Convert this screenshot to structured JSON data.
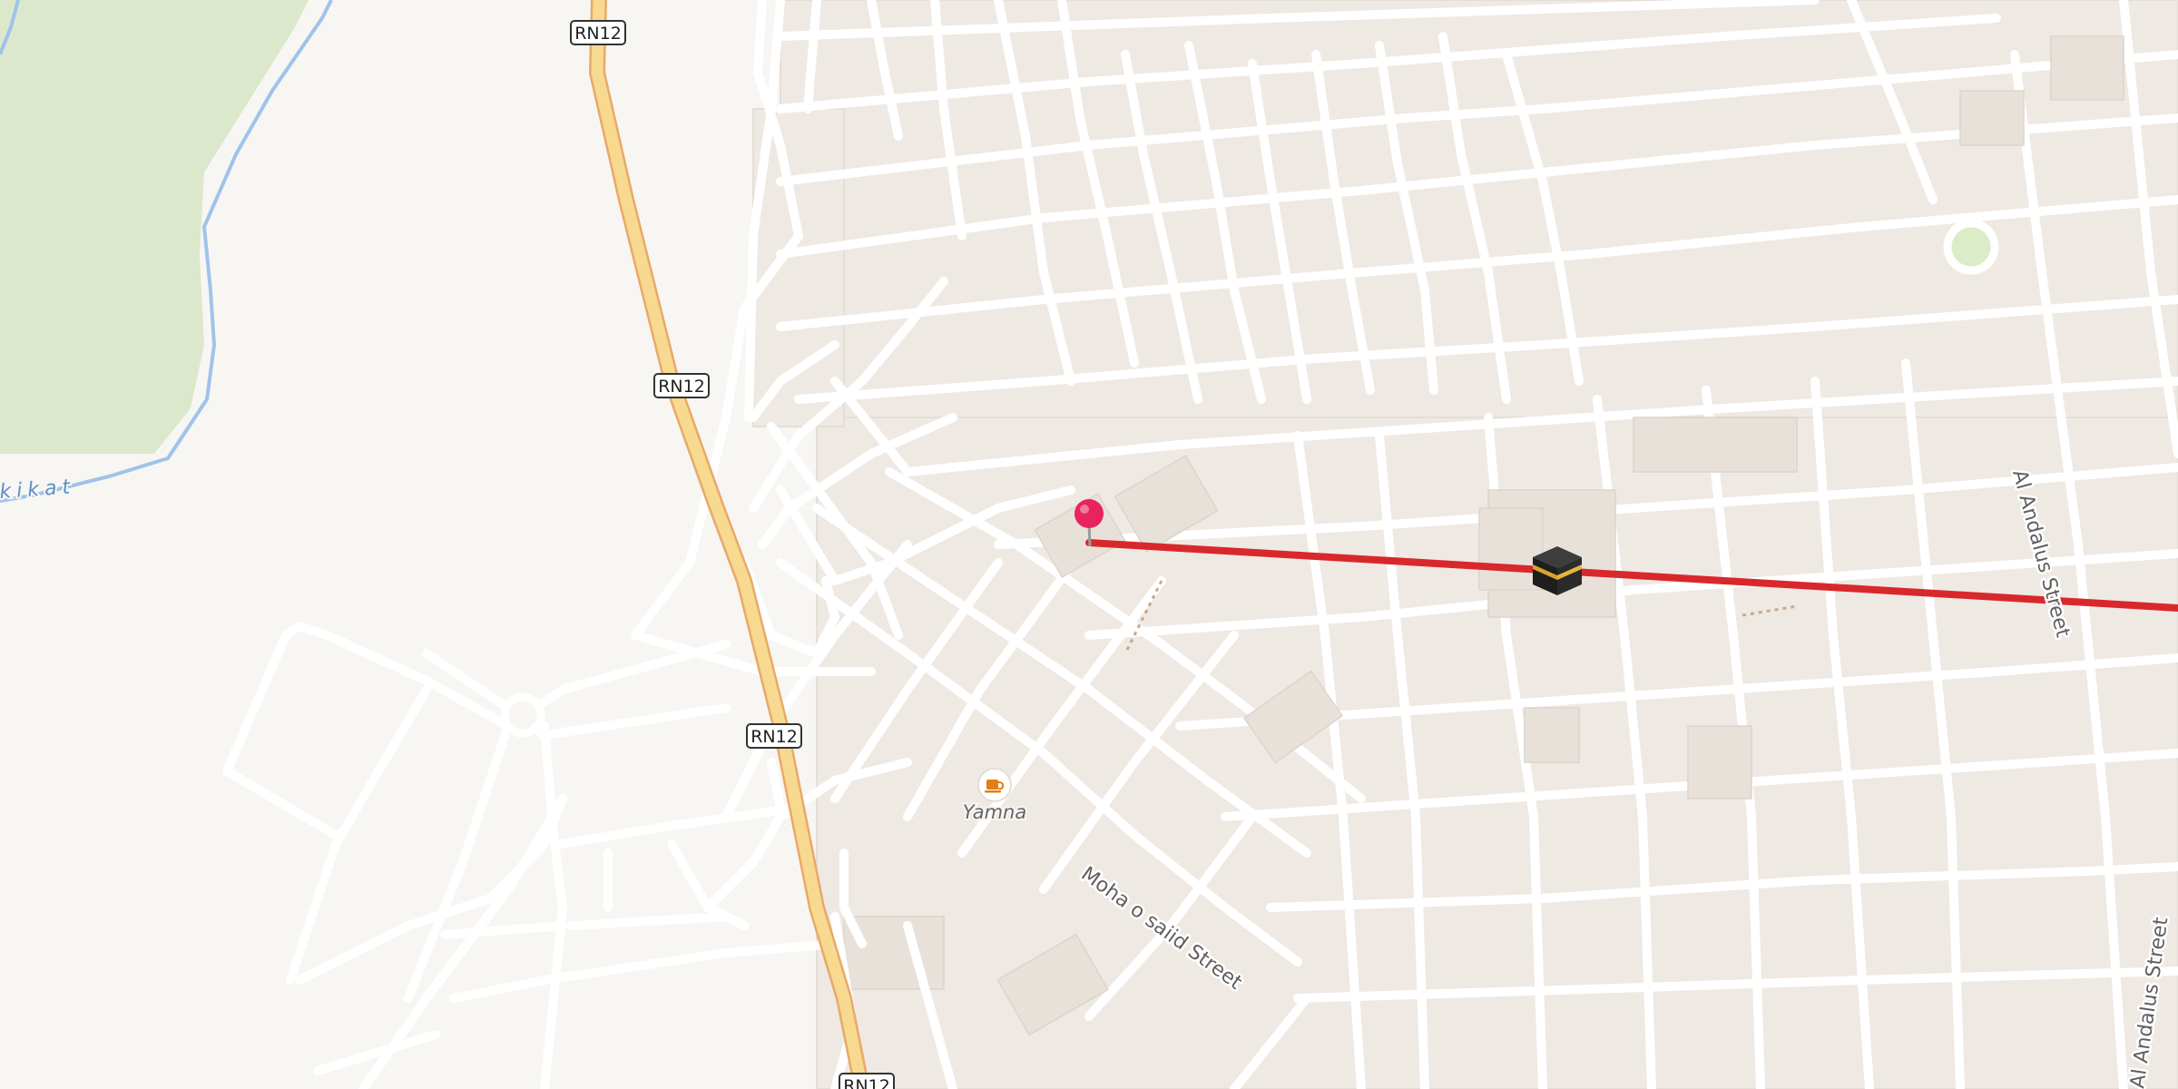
{
  "map": {
    "colors": {
      "background": "#f8f6f3",
      "park": "#dce8cc",
      "water": "#9fc3ea",
      "street": "#ffffff",
      "street_casing": "#e3ded7",
      "block": "#efe9e3",
      "building": "#e8e1da",
      "highway": "#f7d98f",
      "highway_casing": "#e8a96a",
      "route_line": "#d8282c",
      "pin": "#e8245f",
      "roundabout_green": "#dcebc8"
    },
    "road_shields": [
      {
        "label": "RN12"
      },
      {
        "label": "RN12"
      },
      {
        "label": "RN12"
      },
      {
        "label": "RN12"
      }
    ],
    "streets": {
      "al_andalus_1": "Al Andalus Street",
      "al_andalus_2": "Al Andalus Street",
      "moha": "Moha o saiid Street"
    },
    "waterway": {
      "label": "kikat"
    },
    "poi": {
      "name": "Yamna",
      "icon": "cafe-icon"
    },
    "markers": {
      "origin": {
        "icon": "map-pin-icon"
      },
      "destination": {
        "icon": "kaaba-icon"
      }
    },
    "route": {
      "type": "qibla-direction-line"
    }
  }
}
